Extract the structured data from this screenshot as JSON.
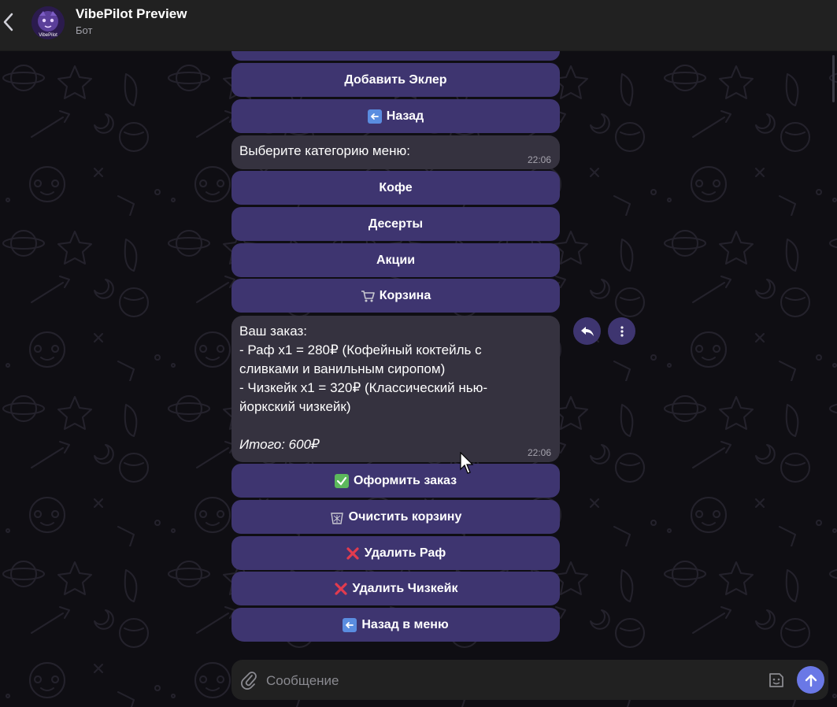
{
  "header": {
    "title": "VibePilot Preview",
    "subtitle": "Бот",
    "avatar_text": "VibePilot"
  },
  "chat": {
    "top_buttons": [
      {
        "label": "Добавить Эклер",
        "emoji": ""
      },
      {
        "label": "Назад",
        "emoji": "back-arrow-icon"
      }
    ],
    "menu_message": {
      "text": "Выберите категорию меню:",
      "time": "22:06"
    },
    "menu_buttons": [
      {
        "label": "Кофе",
        "emoji": ""
      },
      {
        "label": "Десерты",
        "emoji": ""
      },
      {
        "label": "Акции",
        "emoji": ""
      },
      {
        "label": "Корзина",
        "emoji": "cart-icon"
      }
    ],
    "order_message": {
      "lines": [
        "Ваш заказ:",
        "- Раф x1 = 280₽ (Кофейный коктейль с",
        "сливками и ванильным сиропом)",
        "- Чизкейк x1 = 320₽ (Классический нью-",
        "йоркский чизкейк)",
        ""
      ],
      "total": "Итого: 600₽",
      "time": "22:06"
    },
    "order_buttons": [
      {
        "label": "Оформить заказ",
        "emoji": "check-mark-icon"
      },
      {
        "label": "Очистить корзину",
        "emoji": "wastebasket-icon"
      },
      {
        "label": "Удалить Раф",
        "emoji": "cross-mark-icon"
      },
      {
        "label": "Удалить Чизкейк",
        "emoji": "cross-mark-icon"
      },
      {
        "label": "Назад в меню",
        "emoji": "back-arrow-icon"
      }
    ]
  },
  "composer": {
    "placeholder": "Сообщение",
    "value": ""
  },
  "colors": {
    "background": "#0f0e13",
    "keyboard_button": "#3e3570",
    "message_bubble": "#35323f",
    "send_button": "#6a78e6",
    "header": "#212121"
  }
}
